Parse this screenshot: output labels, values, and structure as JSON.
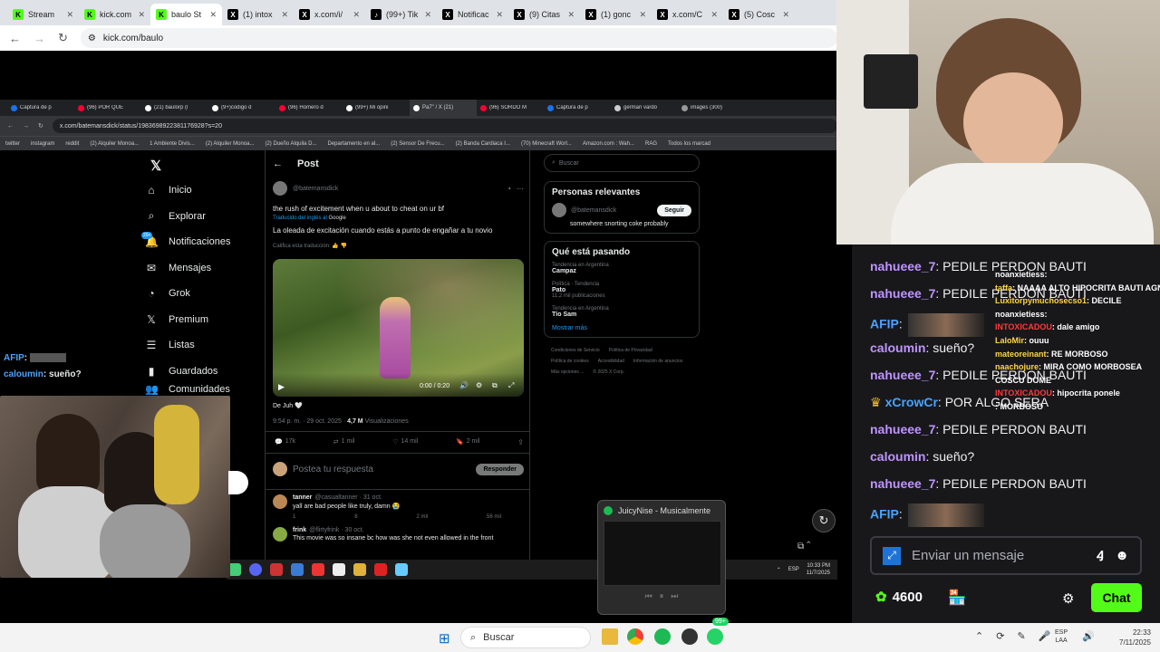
{
  "outer_tabs": [
    {
      "label": "Stream",
      "fav": "K",
      "color": "#53fc18",
      "fg": "#000"
    },
    {
      "label": "kick.com",
      "fav": "K",
      "color": "#53fc18",
      "fg": "#000"
    },
    {
      "label": "baulo St",
      "fav": "K",
      "color": "#53fc18",
      "fg": "#000",
      "active": true
    },
    {
      "label": "(1) intox",
      "fav": "X",
      "color": "#000",
      "fg": "#fff"
    },
    {
      "label": "x.com/i/",
      "fav": "X",
      "color": "#000",
      "fg": "#fff"
    },
    {
      "label": "(99+) Tik",
      "fav": "♪",
      "color": "#000",
      "fg": "#fff"
    },
    {
      "label": "Notificac",
      "fav": "X",
      "color": "#000",
      "fg": "#fff"
    },
    {
      "label": "(9) Citas",
      "fav": "X",
      "color": "#000",
      "fg": "#fff"
    },
    {
      "label": "(1) gonc",
      "fav": "X",
      "color": "#000",
      "fg": "#fff"
    },
    {
      "label": "x.com/C",
      "fav": "X",
      "color": "#000",
      "fg": "#fff"
    },
    {
      "label": "(5) Cosc",
      "fav": "X",
      "color": "#000",
      "fg": "#fff"
    }
  ],
  "outer_url": "kick.com/baulo",
  "inner_tabs": [
    "Captura de p",
    "(96) POR QUÉ",
    "(21) baulorp (l",
    "(9+)codigo d",
    "(96) Homero d",
    "(99+) Mi opini",
    "Pa7\" / X (21)",
    "(96) SORDO M",
    "Captura de p",
    "german vardo",
    "images (300)"
  ],
  "inner_tab_colors": [
    "#1a73e8",
    "#ff0033",
    "#fff",
    "#fff",
    "#ff0033",
    "#fff",
    "#fff",
    "#ff0033",
    "#1a73e8",
    "#ccc",
    "#999"
  ],
  "inner_url": "x.com/batemansdick/status/1983698922381176928?s=20",
  "bookmarks": [
    "twitter",
    "instagram",
    "reddit",
    "(2) Alquiler Monoa...",
    "1 Ambiente Divis...",
    "(2) Alquiler Monoa...",
    "(2) Dueño Alquila D...",
    "Departamento en al...",
    "(2) Sensor De Frecu...",
    "(2) Banda Cardiaca I...",
    "(70) Minecraft Worl...",
    "Amazon.com : Wah...",
    "RAG",
    "Todos los marcad"
  ],
  "twitter": {
    "nav": [
      {
        "label": "Inicio",
        "icon": "⌂",
        "name": "home"
      },
      {
        "label": "Explorar",
        "icon": "⌕",
        "name": "explore"
      },
      {
        "label": "Notificaciones",
        "icon": "🔔",
        "name": "notifications",
        "badge": "20+"
      },
      {
        "label": "Mensajes",
        "icon": "✉",
        "name": "messages"
      },
      {
        "label": "Grok",
        "icon": "◔",
        "name": "grok"
      },
      {
        "label": "Premium",
        "icon": "𝕏",
        "name": "premium"
      },
      {
        "label": "Listas",
        "icon": "☰",
        "name": "lists"
      },
      {
        "label": "Guardados",
        "icon": "▮",
        "name": "bookmarks"
      },
      {
        "label": "Comunidades",
        "icon": "👥",
        "name": "communities"
      }
    ],
    "back": "←",
    "post_title": "Post",
    "author_handle": "@batemansdick",
    "post_text": "the rush of excitement when u about to cheat on ur bf",
    "translated_from": "Traducido del inglés al",
    "translated_by": "Google",
    "translation": "La oleada de excitación cuando estás a punto de engañar a tu novio",
    "rate": "Califica esta traducción:",
    "video_time": "0:00 / 0:20",
    "caption": "De Juh 🤍",
    "meta_time": "9:54 p. m. · 29 oct. 2025 ·",
    "views": "4,7 M",
    "views_label": "Visualizaciones",
    "stats": [
      {
        "icon": "💬",
        "value": "17k"
      },
      {
        "icon": "⇄",
        "value": "1 mil"
      },
      {
        "icon": "♡",
        "value": "14 mil"
      },
      {
        "icon": "🔖",
        "value": "2 mil"
      }
    ],
    "reply_placeholder": "Postea tu respuesta",
    "reply_button": "Responder",
    "replies": [
      {
        "name": "tanner",
        "handle": "@casualtanner · 31 oct.",
        "text": "yall are bad people like truly, damn 😭",
        "stats": [
          "1",
          "8",
          "2 mil",
          "56 mil"
        ]
      },
      {
        "name": "frink",
        "handle": "@flirtyfrink · 30 oct.",
        "text": "This movie was so insane bc how was she not even allowed in the front"
      }
    ],
    "search": "Buscar",
    "relevant_title": "Personas relevantes",
    "relevant_handle": "@batemansdick",
    "relevant_bio": "somewhere snorting coke probably",
    "follow": "Seguir",
    "whats_title": "Qué está pasando",
    "trends": [
      {
        "context": "Tendencia en Argentina",
        "name": "Campaz",
        "count": ""
      },
      {
        "context": "Política · Tendencia",
        "name": "Pato",
        "count": "11,2 mil publicaciones"
      },
      {
        "context": "Tendencia en Argentina",
        "name": "Tío Sam",
        "count": ""
      }
    ],
    "show_more": "Mostrar más",
    "footer": [
      "Condiciones de Servicio",
      "Política de Privacidad",
      "Política de cookies",
      "Accesibilidad",
      "Información de anuncios",
      "Más opciones ...",
      "© 2025 X Corp."
    ]
  },
  "inner_clock": {
    "time": "10:33 PM",
    "date": "11/7/2025",
    "lang": "ESP"
  },
  "cam_overlay_chat": [
    {
      "user": "AFIP",
      "text": ":",
      "color": "#4aa3ff"
    },
    {
      "user": "caloumin",
      "text": ": sueño?",
      "color": "#4aa3ff"
    }
  ],
  "spotify": {
    "title": "JuicyNise - Musicalmente"
  },
  "chat": {
    "messages": [
      {
        "user": "nahueee_7",
        "text": ": PEDILE PERDON BAUTI",
        "color": "#bf94ff"
      },
      {
        "user": "nahueee_7",
        "text": ": PEDILE PERDON BAUTI",
        "color": "#bf94ff"
      },
      {
        "user": "AFIP",
        "text": ":",
        "color": "#4aa3ff",
        "emote": true
      },
      {
        "user": "caloumin",
        "text": ": sueño?",
        "color": "#bf94ff"
      },
      {
        "user": "nahueee_7",
        "text": ": PEDILE PERDON BAUTI",
        "color": "#bf94ff"
      },
      {
        "user": "xCrowCr",
        "text": ": POR ALGO SERA",
        "color": "#4aa3ff",
        "crown": true
      },
      {
        "user": "nahueee_7",
        "text": ": PEDILE PERDON BAUTI",
        "color": "#bf94ff"
      },
      {
        "user": "caloumin",
        "text": ": sueño?",
        "color": "#bf94ff"
      },
      {
        "user": "nahueee_7",
        "text": ": PEDILE PERDON BAUTI",
        "color": "#bf94ff"
      },
      {
        "user": "AFIP",
        "text": ":",
        "color": "#4aa3ff",
        "emote": true
      }
    ],
    "overlay": [
      {
        "user": "noanxietiess",
        "text": ":",
        "color": "#fff"
      },
      {
        "user": "taffa",
        "text": ": NAAAA ALTO HIPOCRITA BAUTI AGNONE",
        "color": "#ffd54a"
      },
      {
        "user": "Luxitorpymuchosecso1",
        "text": ": DECILE",
        "color": "#ffd54a"
      },
      {
        "user": "noanxietiess",
        "text": ":",
        "color": "#fff"
      },
      {
        "user": "INTOXICADOU",
        "text": ": dale amigo",
        "color": "#ff3a3a"
      },
      {
        "user": "LaloMir",
        "text": ": ouuu",
        "color": "#ffd54a"
      },
      {
        "user": "mateoreinant",
        "text": ": RE MORBOSO",
        "color": "#ffd54a"
      },
      {
        "user": "naachojure",
        "text": ": MIRA COMO MORBOSEA",
        "color": "#ffd54a"
      },
      {
        "user": "COSCU DOME",
        "text": "",
        "color": "#fff"
      },
      {
        "user": "INTOXICADOU",
        "text": ": hipocrita ponele",
        "color": "#ff3a3a"
      },
      {
        "user": "",
        "text": ": MORBOSO",
        "color": "#fff"
      }
    ],
    "input_placeholder": "Enviar un mensaje",
    "points": "4600",
    "chat_button": "Chat"
  },
  "win_taskbar": {
    "search": "Buscar",
    "lang1": "ESP",
    "lang2": "LAA",
    "time": "22:33",
    "date": "7/11/2025",
    "badge": "99+"
  }
}
